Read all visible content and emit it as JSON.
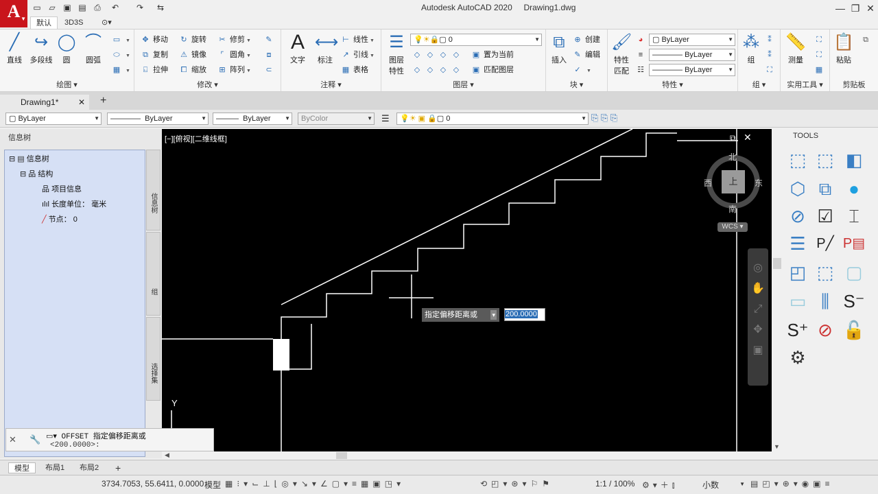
{
  "app": {
    "logo": "A",
    "title": "Autodesk AutoCAD 2020",
    "document": "Drawing1.dwg"
  },
  "ribbon_tabs": [
    "默认",
    "3D3S"
  ],
  "ribbon": {
    "draw": {
      "title": "绘图",
      "line": "直线",
      "polyline": "多段线",
      "circle": "圆",
      "arc": "圆弧"
    },
    "modify": {
      "title": "修改",
      "move": "移动",
      "rotate": "旋转",
      "trim": "修剪",
      "copy": "复制",
      "mirror": "镜像",
      "fillet": "圆角",
      "stretch": "拉伸",
      "scale": "缩放",
      "array": "阵列"
    },
    "annotation": {
      "title": "注释",
      "text": "文字",
      "dimension": "标注",
      "linear": "线性",
      "leader": "引线",
      "table": "表格"
    },
    "layers": {
      "title": "图层",
      "layer_props_1": "图层",
      "layer_props_2": "特性",
      "layer_value": "0",
      "set_current": "置为当前",
      "match_layer": "匹配图层"
    },
    "block": {
      "title": "块",
      "insert": "插入",
      "create": "创建",
      "edit": "编辑"
    },
    "properties": {
      "title": "特性",
      "match_1": "特性",
      "match_2": "匹配",
      "color": "ByLayer",
      "linetype": "ByLayer",
      "lineweight": "ByLayer"
    },
    "groups": {
      "title": "组",
      "group": "组"
    },
    "utilities": {
      "title": "实用工具",
      "measure": "测量"
    },
    "clipboard": {
      "title": "剪贴板",
      "paste": "粘贴"
    }
  },
  "file_tabs": {
    "active": "Drawing1*",
    "close": "✕",
    "new": "+"
  },
  "prop_bar": {
    "color": "ByLayer",
    "linetype": "ByLayer",
    "lineweight": "ByLayer",
    "plotstyle": "ByColor",
    "layer": "0"
  },
  "left_palette": {
    "title": "信息树",
    "tree": [
      {
        "toggle": "⊟",
        "icon": "▤",
        "label": "信息树"
      },
      {
        "toggle": "⊟",
        "icon": "品",
        "label": "结构"
      },
      {
        "toggle": "",
        "icon": "品",
        "label": "项目信息"
      },
      {
        "toggle": "",
        "icon": "ılıl",
        "label": "长度单位：  毫米"
      },
      {
        "toggle": "",
        "icon": "╱",
        "label": "节点：   0"
      }
    ],
    "side_tabs": [
      "信息树",
      "组",
      "选择集"
    ]
  },
  "viewport": {
    "label": "[−][俯视][二维线框]",
    "viewcube": {
      "north": "北",
      "south": "南",
      "west": "西",
      "east": "东",
      "top": "上",
      "wcs": "WCS"
    },
    "tooltip": "指定偏移距离或",
    "input_value": "200.0000",
    "ucs_y": "Y"
  },
  "command_line": {
    "line1": "OFFSET 指定偏移距离或",
    "line2": "<200.0000>:"
  },
  "tool_palette": {
    "title": "TOOLS"
  },
  "layout_tabs": [
    "模型",
    "布局1",
    "布局2"
  ],
  "status": {
    "coords": "3734.7053, 55.6411, 0.0000",
    "model": "模型",
    "scale": "1:1 / 100%",
    "units": "小数"
  }
}
